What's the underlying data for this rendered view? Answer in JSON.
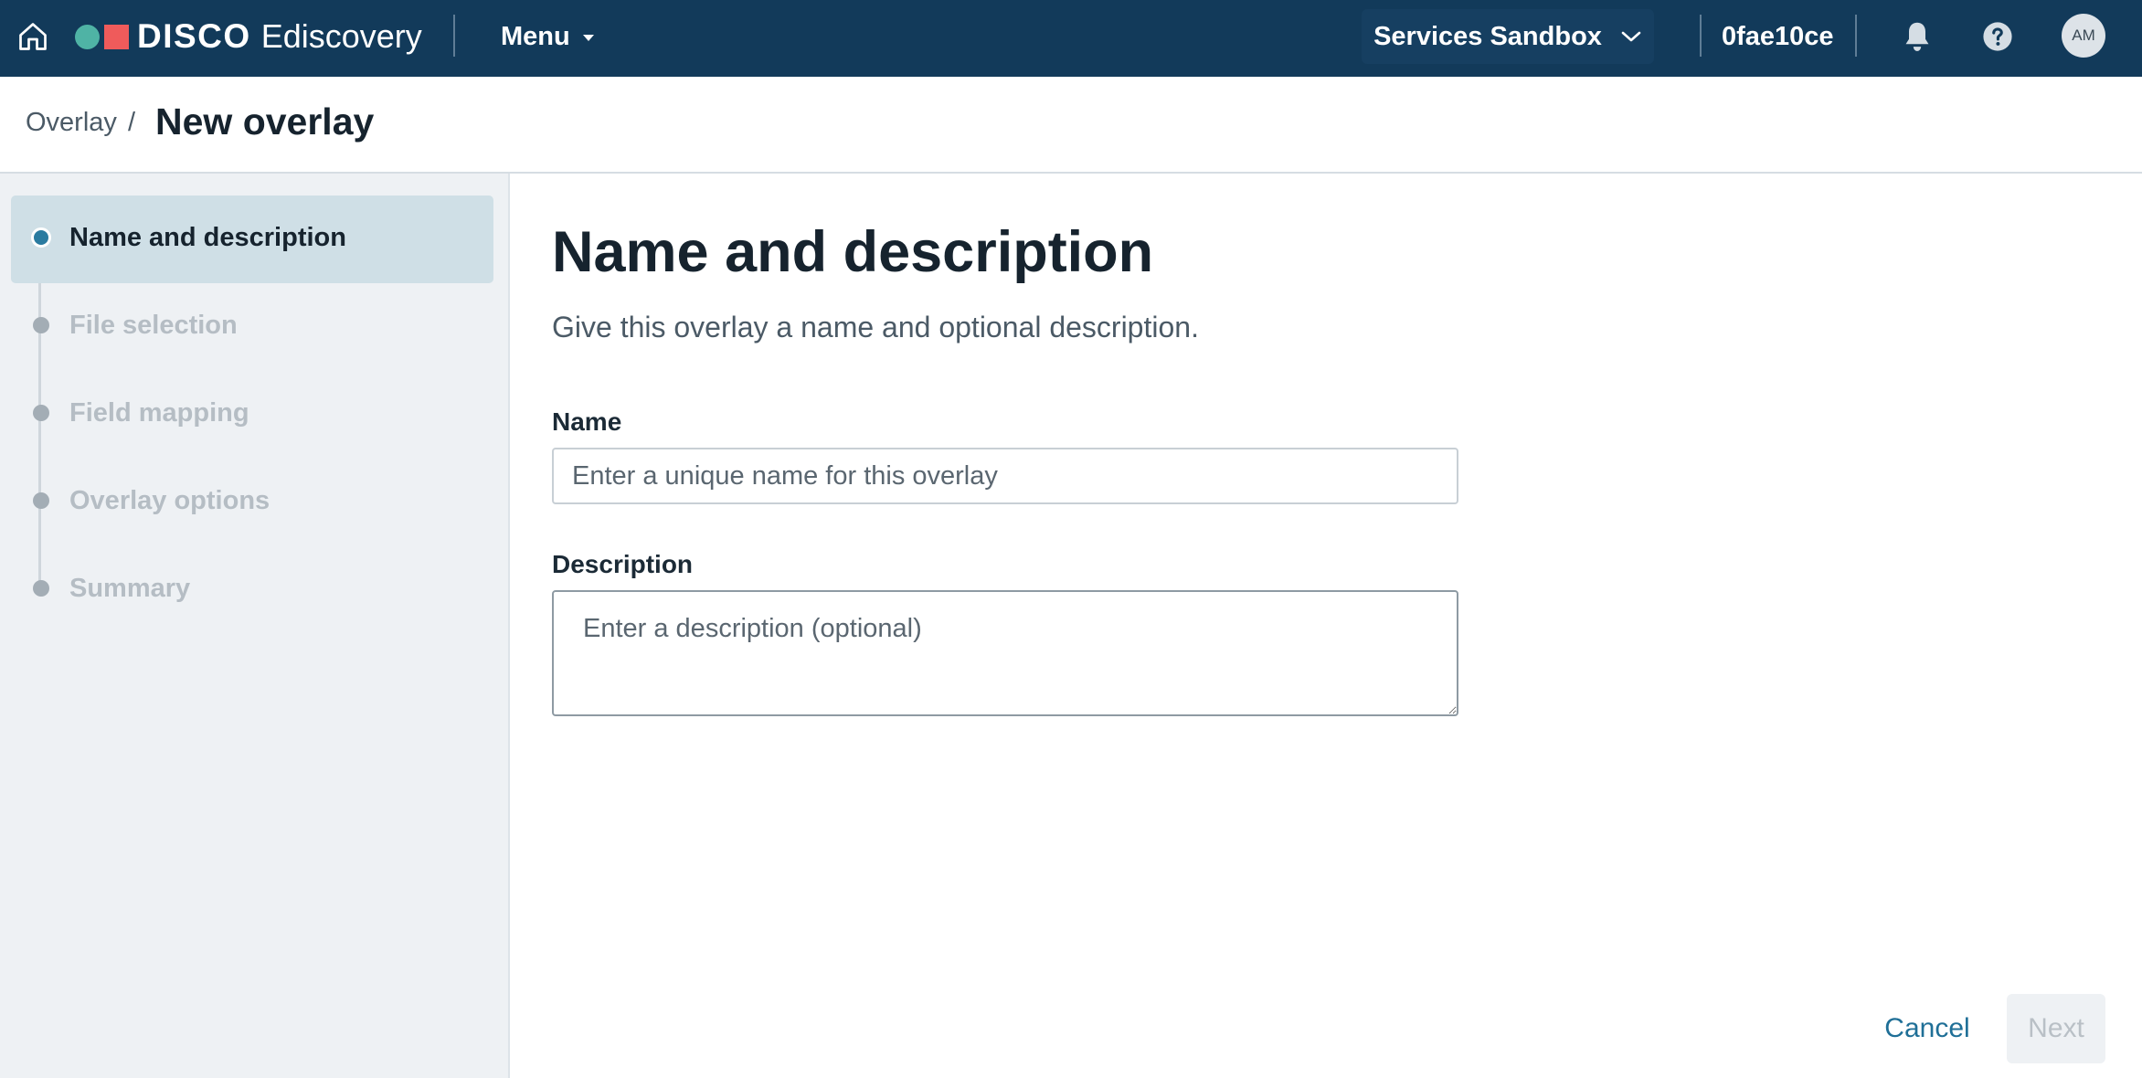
{
  "header": {
    "brand": "DISCO",
    "product": "Ediscovery",
    "menu_label": "Menu",
    "workspace": "Services Sandbox",
    "tenant_id": "0fae10ce",
    "avatar_initials": "AM",
    "colors": {
      "bar": "#123a5a",
      "logo_dot": "#4fb3a5",
      "logo_square": "#ef5b5b"
    },
    "icons": [
      "home-icon",
      "chevron-down-icon",
      "bell-icon",
      "help-icon"
    ]
  },
  "breadcrumb": {
    "parent": "Overlay",
    "separator": "/",
    "current": "New overlay"
  },
  "steps": [
    {
      "label": "Name and description",
      "state": "active"
    },
    {
      "label": "File selection",
      "state": "disabled"
    },
    {
      "label": "Field mapping",
      "state": "disabled"
    },
    {
      "label": "Overlay options",
      "state": "disabled"
    },
    {
      "label": "Summary",
      "state": "disabled"
    }
  ],
  "main": {
    "title": "Name and description",
    "subtitle": "Give this overlay a name and optional description.",
    "name_label": "Name",
    "name_placeholder": "Enter a unique name for this overlay",
    "name_value": "",
    "description_label": "Description",
    "description_placeholder": "Enter a description (optional)",
    "description_value": ""
  },
  "footer": {
    "cancel_label": "Cancel",
    "next_label": "Next",
    "next_enabled": false,
    "accent": "#1f6f97"
  }
}
